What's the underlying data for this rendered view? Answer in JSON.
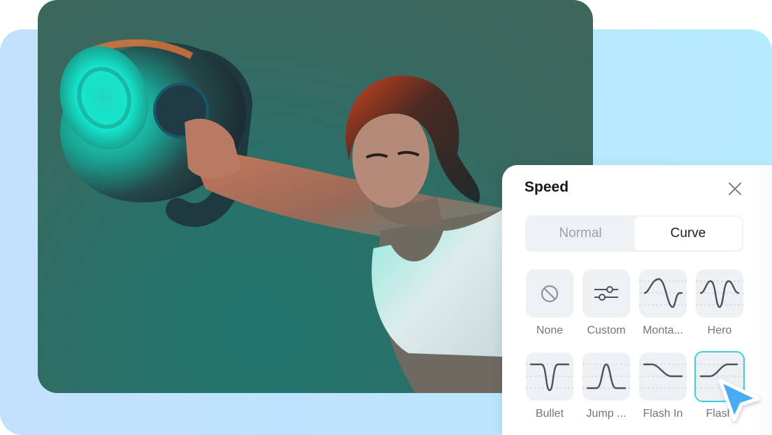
{
  "colors": {
    "background_panel": "#bde3fd",
    "photo_bg": "#2a7068",
    "accent_selected_border": "#3fd0d4",
    "cursor_blue": "#4aabf5",
    "tile_bg": "#eef1f4",
    "title_text": "#15171c",
    "muted_text": "#71767c"
  },
  "photo": {
    "description": "Woman in white sports bra swinging a kettlebell, teal and orange studio lighting"
  },
  "speed_panel": {
    "title": "Speed",
    "close_icon": "close-icon",
    "tabs": [
      {
        "label": "Normal",
        "active": false
      },
      {
        "label": "Curve",
        "active": true
      }
    ],
    "presets": [
      {
        "label": "None",
        "icon": "none-icon",
        "selected": false
      },
      {
        "label": "Custom",
        "icon": "sliders-icon",
        "selected": false
      },
      {
        "label": "Monta...",
        "icon": "montage-curve-icon",
        "selected": false
      },
      {
        "label": "Hero",
        "icon": "hero-curve-icon",
        "selected": false
      },
      {
        "label": "Bullet",
        "icon": "bullet-curve-icon",
        "selected": false
      },
      {
        "label": "Jump ...",
        "icon": "jump-cut-curve-icon",
        "selected": false
      },
      {
        "label": "Flash In",
        "icon": "flash-in-curve-icon",
        "selected": false
      },
      {
        "label": "Flash",
        "icon": "flash-out-curve-icon",
        "selected": true
      }
    ]
  }
}
